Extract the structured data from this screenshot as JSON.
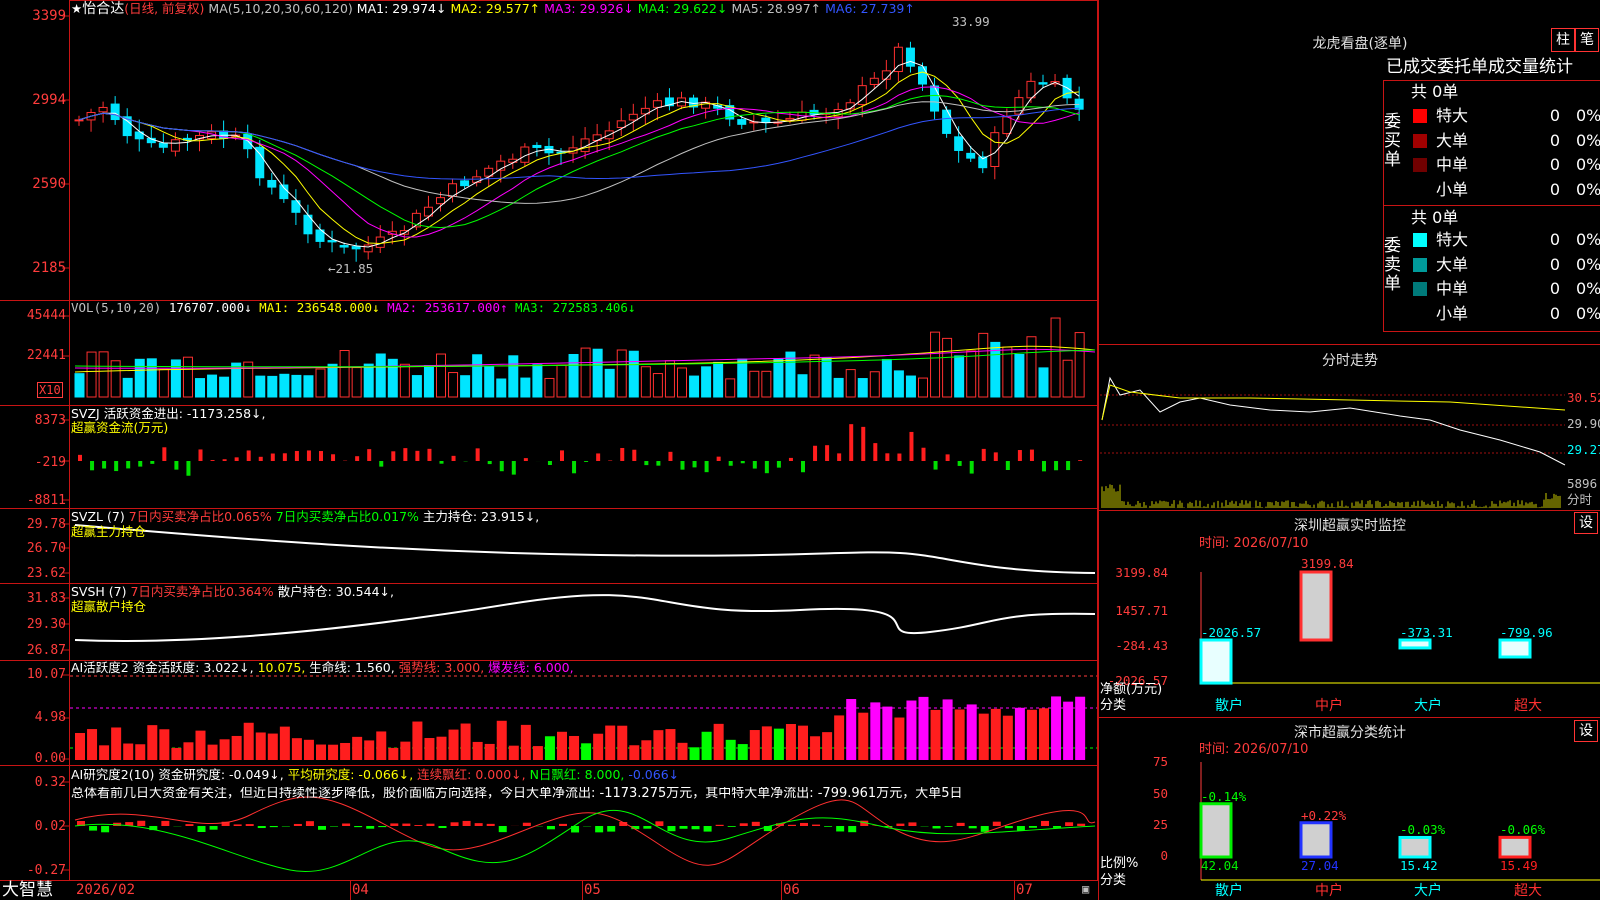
{
  "stock": {
    "name": "怡合达",
    "mode": "(日线, 前复权)"
  },
  "price_panel": {
    "ma_label": "MA(5,10,20,30,60,120)",
    "ma": [
      {
        "text": "MA1: 29.974↓",
        "color": "#ffffff"
      },
      {
        "text": "MA2: 29.577↑",
        "color": "#ffff00"
      },
      {
        "text": "MA3: 29.926↓",
        "color": "#ff00ff"
      },
      {
        "text": "MA4: 29.622↓",
        "color": "#00ff00"
      },
      {
        "text": "MA5: 28.997↑",
        "color": "#c0c0c0"
      },
      {
        "text": "MA6: 27.739↑",
        "color": "#3355ff"
      }
    ],
    "axis": [
      "3399",
      "2994",
      "2590",
      "2185"
    ],
    "high_note": "33.99",
    "low_note": "←21.85"
  },
  "vol_panel": {
    "label": "VOL(5,10,20)",
    "values": [
      {
        "text": "176707.000↓",
        "color": "#ffffff"
      },
      {
        "text": "MA1: 236548.000↓",
        "color": "#ffff00"
      },
      {
        "text": "MA2: 253617.000↑",
        "color": "#ff00ff"
      },
      {
        "text": "MA3: 272583.406↓",
        "color": "#00ff00"
      }
    ],
    "axis": [
      "45444",
      "22441"
    ],
    "unit": "X10"
  },
  "svzj_panel": {
    "line1": "SVZJ  活跃资金进出: -1173.258↓,",
    "line2": "超赢资金流(万元)",
    "axis": [
      "8373",
      "-219",
      "-8811"
    ]
  },
  "svzl_panel": {
    "label": "SVZL (7)",
    "part1": "7日内买卖净占比0.065%",
    "part2": "7日内买卖净占比0.017%",
    "part3": "主力持仓: 23.915↓,",
    "line2": "超赢主力持仓",
    "axis": [
      "29.78",
      "26.70",
      "23.62"
    ]
  },
  "svsh_panel": {
    "label": "SVSH (7)",
    "part1": "7日内买卖净占比0.364%",
    "part2": "散户持仓: 30.544↓,",
    "line2": "超赢散户持仓",
    "axis": [
      "31.83",
      "29.30",
      "26.87"
    ]
  },
  "ai_active_panel": {
    "label": "AI活跃度2 资金活跃度: 3.022↓,",
    "v2": "10.075,",
    "v3": "生命线: 1.560,",
    "v4": "强势线: 3.000,",
    "v5": "爆发线: 6.000,",
    "axis": [
      "10.07",
      "4.98",
      "0.00"
    ]
  },
  "ai_research_panel": {
    "label": "AI研究度2(10) 资金研究度: -0.049↓,",
    "v2": "平均研究度: -0.066↓,",
    "v3": "连续飘红: 0.000↓,",
    "v4": "N日飘红: 8.000,",
    "v5": "-0.066↓",
    "summary": "总体看前几日大资金有关注，但近日持续性逐步降低，股价面临方向选择，今日大单净流出: -1173.275万元，其中特大单净流出: -799.961万元，大单5日",
    "axis": [
      "0.32",
      "0.02",
      "-0.27"
    ]
  },
  "bottom_bar": {
    "brand": "大智慧",
    "dates": [
      "2026/02",
      "04",
      "05",
      "06",
      "07"
    ]
  },
  "longhu": {
    "title": "龙虎看盘(逐单)",
    "btn1": "柱",
    "btn2": "笔",
    "tabs": "已成交委托单成交量统计",
    "buy_label": "委买单",
    "sell_label": "委卖单",
    "buy_total": "共 0单",
    "sell_total": "共 0单",
    "buy_rows": [
      {
        "name": "特大",
        "count": "0",
        "pct": "0%",
        "color": "#ff0000"
      },
      {
        "name": "大单",
        "count": "0",
        "pct": "0%",
        "color": "#a00000"
      },
      {
        "name": "中单",
        "count": "0",
        "pct": "0%",
        "color": "#700000"
      },
      {
        "name": "小单",
        "count": "0",
        "pct": "0%",
        "color": ""
      }
    ],
    "sell_rows": [
      {
        "name": "特大",
        "count": "0",
        "pct": "0%",
        "color": "#00ffff"
      },
      {
        "name": "大单",
        "count": "0",
        "pct": "0%",
        "color": "#009a9a"
      },
      {
        "name": "中单",
        "count": "0",
        "pct": "0%",
        "color": "#007a7a"
      },
      {
        "name": "小单",
        "count": "0",
        "pct": "0%",
        "color": ""
      }
    ]
  },
  "fenshi": {
    "title": "分时走势",
    "axis": [
      "30.52",
      "29.90",
      "29.27"
    ],
    "vol": "5896",
    "vol_label": "分时"
  },
  "monitor": {
    "title": "深圳超赢实时监控",
    "btn": "设",
    "time": "时间: 2026/07/10",
    "axis": [
      "3199.84",
      "1457.71",
      "-284.43",
      "-2026.57"
    ],
    "y_label1": "净额(万元)",
    "y_label2": "分类",
    "categories": [
      "散户",
      "中户",
      "大户",
      "超大"
    ],
    "bars": [
      {
        "label": "-2026.57",
        "value": -2026.57
      },
      {
        "label": "3199.84",
        "value": 3199.84
      },
      {
        "label": "-373.31",
        "value": -373.31
      },
      {
        "label": "-799.96",
        "value": -799.96
      }
    ]
  },
  "classify": {
    "title": "深市超赢分类统计",
    "btn": "设",
    "time": "时间: 2026/07/10",
    "axis": [
      "75",
      "50",
      "25",
      "0"
    ],
    "y_label1": "比例%",
    "y_label2": "分类",
    "categories": [
      "散户",
      "中户",
      "大户",
      "超大"
    ],
    "bars": [
      {
        "change": "-0.14%",
        "value": 42.04,
        "label": "42.04",
        "color": "#00ee00"
      },
      {
        "change": "+0.22%",
        "value": 27.04,
        "label": "27.04",
        "color": "#2233ff"
      },
      {
        "change": "-0.03%",
        "value": 15.42,
        "label": "15.42",
        "color": "#00ffff"
      },
      {
        "change": "-0.06%",
        "value": 15.49,
        "label": "15.49",
        "color": "#ff2020"
      }
    ]
  }
}
